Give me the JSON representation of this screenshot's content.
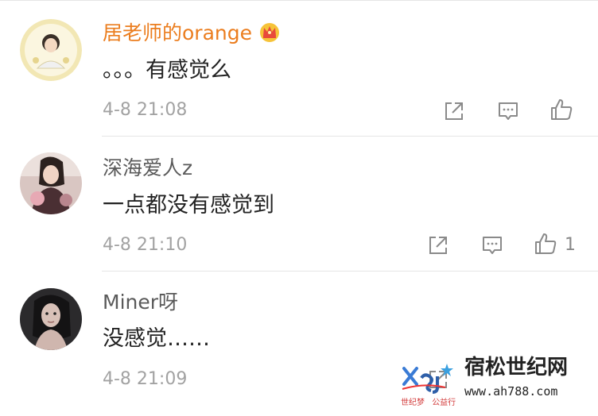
{
  "comments": [
    {
      "username": "居老师的orange",
      "user_style": "vip",
      "badge": "crown-icon",
      "text": "。。。有感觉么",
      "time": "4-8 21:08",
      "like_count": ""
    },
    {
      "username": "深海爱人z",
      "user_style": "normal",
      "badge": "",
      "text": "一点都没有感觉到",
      "time": "4-8 21:10",
      "like_count": "1"
    },
    {
      "username": "Miner呀",
      "user_style": "normal",
      "badge": "",
      "text": "没感觉……",
      "time": "4-8 21:09",
      "like_count": ""
    }
  ],
  "watermark": {
    "title": "宿松世纪网",
    "url": "www.ah788.com",
    "sub_left": "世纪梦",
    "sub_right": "公益行"
  },
  "colors": {
    "vip_name": "#eb7d1e",
    "name": "#5a5a5a",
    "text": "#222222",
    "meta": "#a2a2a2",
    "icon": "#8a8a8a"
  }
}
